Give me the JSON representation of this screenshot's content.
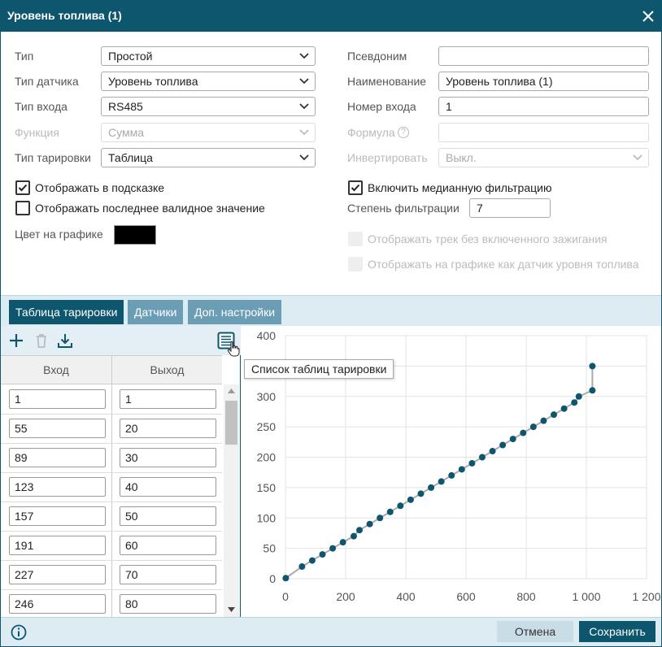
{
  "window": {
    "title": "Уровень топлива (1)"
  },
  "form_left": [
    {
      "label": "Тип",
      "value": "Простой",
      "disabled": false
    },
    {
      "label": "Тип датчика",
      "value": "Уровень топлива",
      "disabled": false
    },
    {
      "label": "Тип входа",
      "value": "RS485",
      "disabled": false
    },
    {
      "label": "Функция",
      "value": "Сумма",
      "disabled": true
    },
    {
      "label": "Тип тарировки",
      "value": "Таблица",
      "disabled": false
    }
  ],
  "form_right": {
    "alias": {
      "label": "Псевдоним",
      "value": ""
    },
    "name": {
      "label": "Наименование",
      "value": "Уровень топлива (1)"
    },
    "input_number": {
      "label": "Номер входа",
      "value": "1"
    },
    "formula": {
      "label": "Формула",
      "value": ""
    },
    "invert": {
      "label": "Инвертировать",
      "value": "Выкл."
    }
  },
  "checks": {
    "show_in_hint": {
      "label": "Отображать в подсказке",
      "checked": true
    },
    "show_last_valid": {
      "label": "Отображать последнее валидное значение",
      "checked": false
    },
    "median_filter": {
      "label": "Включить медианную фильтрацию",
      "checked": true
    },
    "track_no_ignition": {
      "label": "Отображать трек без включенного зажигания",
      "checked": false
    },
    "show_as_fuel": {
      "label": "Отображать на графике как датчик уровня топлива",
      "checked": false
    }
  },
  "filter_degree": {
    "label": "Степень фильтрации",
    "value": "7"
  },
  "graph_color": {
    "label": "Цвет на графике",
    "color": "#000000"
  },
  "tabs": [
    {
      "label": "Таблица тарировки",
      "active": true
    },
    {
      "label": "Датчики",
      "active": false
    },
    {
      "label": "Доп. настройки",
      "active": false
    }
  ],
  "table": {
    "headers": [
      "Вход",
      "Выход"
    ],
    "rows": [
      [
        "1",
        "1"
      ],
      [
        "55",
        "20"
      ],
      [
        "89",
        "30"
      ],
      [
        "123",
        "40"
      ],
      [
        "157",
        "50"
      ],
      [
        "191",
        "60"
      ],
      [
        "227",
        "70"
      ],
      [
        "246",
        "80"
      ]
    ]
  },
  "tooltip": "Список таблиц тарировки",
  "chart_data": {
    "type": "scatter",
    "xlim": [
      0,
      1200
    ],
    "ylim": [
      0,
      400
    ],
    "x_ticks": [
      "0",
      "200",
      "400",
      "600",
      "800",
      "1 000",
      "1 200"
    ],
    "y_ticks": [
      "0",
      "50",
      "100",
      "150",
      "200",
      "250",
      "300",
      "350",
      "400"
    ],
    "grid": true,
    "x": [
      1,
      55,
      89,
      123,
      157,
      191,
      227,
      246,
      280,
      314,
      348,
      382,
      416,
      450,
      484,
      518,
      552,
      586,
      620,
      654,
      688,
      722,
      756,
      790,
      824,
      858,
      892,
      926,
      960,
      975,
      1020,
      1020
    ],
    "y": [
      1,
      20,
      30,
      40,
      50,
      60,
      70,
      80,
      90,
      100,
      110,
      120,
      130,
      140,
      150,
      160,
      170,
      180,
      190,
      200,
      210,
      220,
      230,
      240,
      250,
      260,
      270,
      280,
      290,
      300,
      310,
      350
    ]
  },
  "footer": {
    "cancel": "Отмена",
    "save": "Сохранить"
  },
  "colors": {
    "primary": "#0d566d",
    "tab_inactive": "#6b9db5",
    "point": "#0d566d",
    "line": "#aaaaaa"
  }
}
